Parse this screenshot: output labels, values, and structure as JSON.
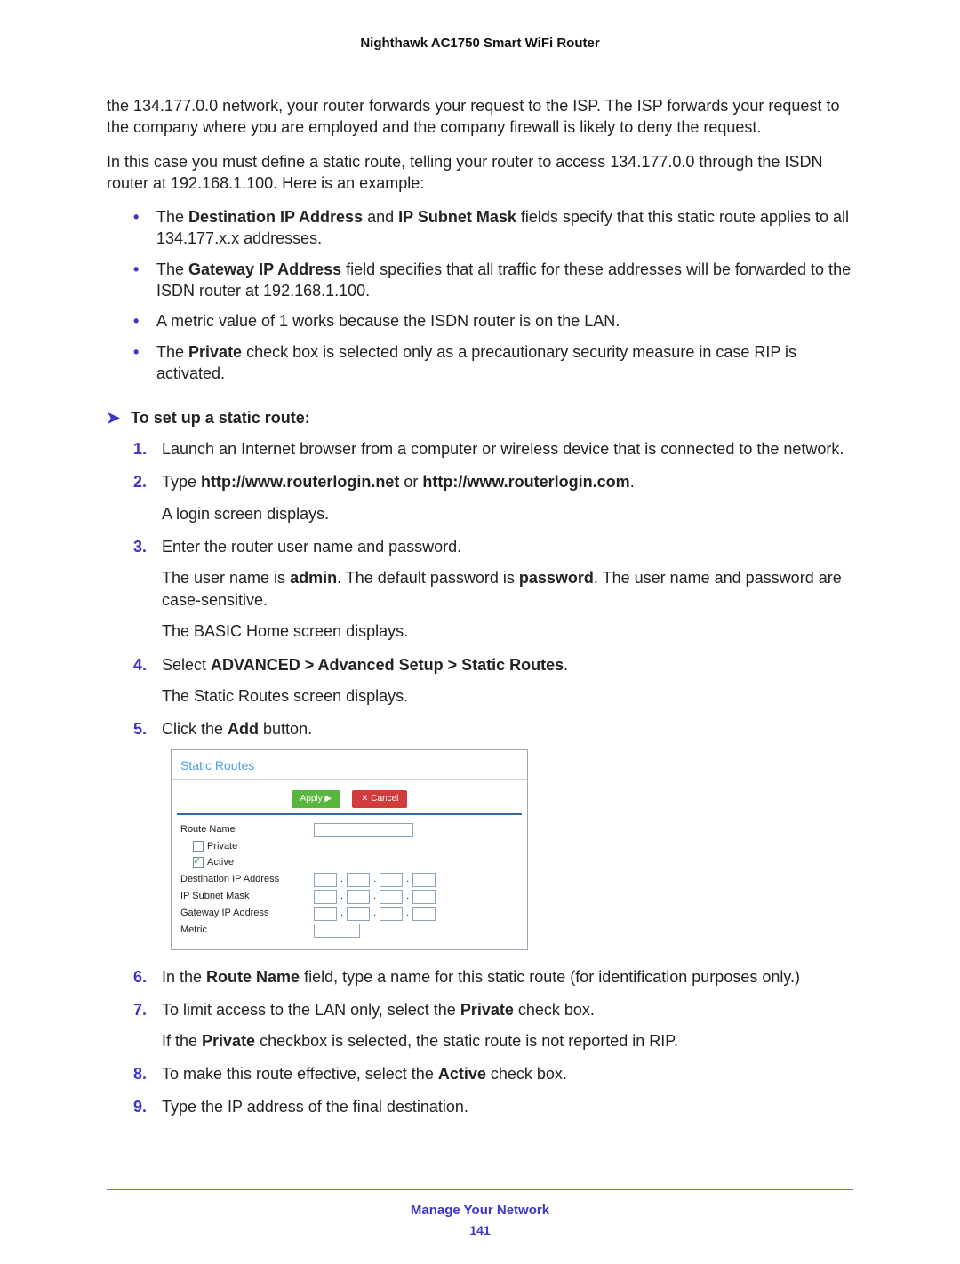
{
  "header": {
    "title": "Nighthawk AC1750 Smart WiFi Router"
  },
  "intro": {
    "para1a": "the 134.177.0.0 network, your router forwards your request to the ISP. The ISP forwards your request to the company where you are employed and the company firewall is likely to deny the request.",
    "para2a": "In this case you must define a static route, telling your router to access 134.177.0.0 through the ISDN router at 192.168.1.100. Here is an example:"
  },
  "bullets": {
    "b1_pre": "The ",
    "b1_bold1": "Destination IP Address",
    "b1_mid": " and ",
    "b1_bold2": "IP Subnet Mask",
    "b1_post": " fields specify that this static route applies to all 134.177.x.x addresses.",
    "b2_pre": "The ",
    "b2_bold": "Gateway IP Address",
    "b2_post": " field specifies that all traffic for these addresses will be forwarded to the ISDN router at 192.168.1.100.",
    "b3": "A metric value of 1 works because the ISDN router is on the LAN.",
    "b4_pre": "The ",
    "b4_bold": "Private",
    "b4_post": " check box is selected only as a precautionary security measure in case RIP is activated."
  },
  "proc": {
    "title": "To set up a static route:"
  },
  "steps": {
    "s1": "Launch an Internet browser from a computer or wireless device that is connected to the network.",
    "s2_pre": "Type ",
    "s2_b1": "http://www.routerlogin.net",
    "s2_mid": " or ",
    "s2_b2": "http://www.routerlogin.com",
    "s2_dot": ".",
    "s2_sub": "A login screen displays.",
    "s3": "Enter the router user name and password.",
    "s3_sub_a": "The user name is ",
    "s3_sub_b1": "admin",
    "s3_sub_c": ". The default password is ",
    "s3_sub_b2": "password",
    "s3_sub_d": ". The user name and password are case-sensitive.",
    "s3_sub2": "The BASIC Home screen displays.",
    "s4_pre": "Select ",
    "s4_bold": "ADVANCED > Advanced Setup > Static Routes",
    "s4_dot": ".",
    "s4_sub": "The Static Routes screen displays.",
    "s5_pre": "Click the ",
    "s5_bold": "Add",
    "s5_post": " button.",
    "s6_pre": "In the ",
    "s6_bold": "Route Name",
    "s6_post": " field, type a name for this static route (for identification purposes only.)",
    "s7_pre": "To limit access to the LAN only, select the ",
    "s7_bold": "Private",
    "s7_post": " check box.",
    "s7_sub_a": "If the ",
    "s7_sub_b": "Private",
    "s7_sub_c": " checkbox is selected, the static route is not reported in RIP.",
    "s8_pre": "To make this route effective, select the ",
    "s8_bold": "Active",
    "s8_post": " check box.",
    "s9": "Type the IP address of the final destination."
  },
  "screenshot": {
    "title": "Static Routes",
    "btn_apply": "Apply ▶",
    "btn_cancel": "✕ Cancel",
    "labels": {
      "route_name": "Route Name",
      "private": "Private",
      "active": "Active",
      "dest_ip": "Destination IP Address",
      "subnet": "IP Subnet Mask",
      "gateway": "Gateway IP Address",
      "metric": "Metric"
    }
  },
  "footer": {
    "section": "Manage Your Network",
    "page": "141"
  }
}
